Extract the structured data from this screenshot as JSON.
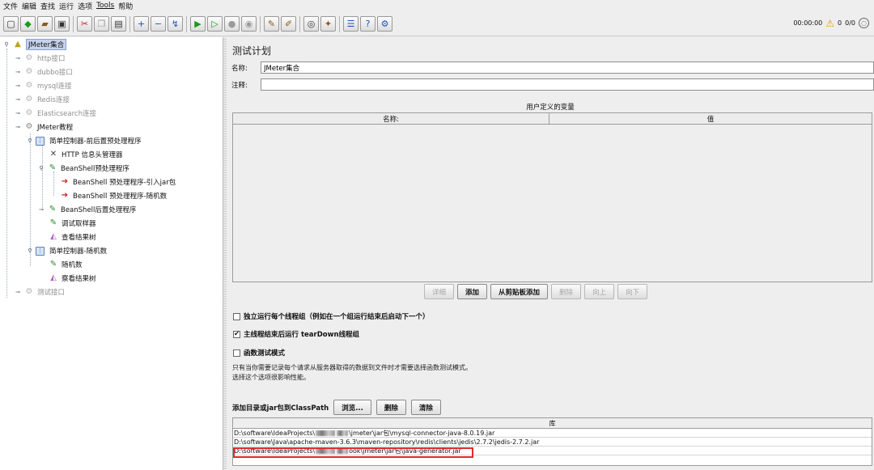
{
  "menu": [
    "文件",
    "编辑",
    "查找",
    "运行",
    "选项",
    "Tools",
    "帮助"
  ],
  "status": {
    "elapsed": "00:00:00",
    "warnings": "0",
    "threads": "0/0"
  },
  "tree": {
    "root": "JMeter集合",
    "nodes": [
      {
        "label": "http接口"
      },
      {
        "label": "dubbo接口"
      },
      {
        "label": "mysql连接"
      },
      {
        "label": "Redis连接"
      },
      {
        "label": "Elasticsearch连接"
      },
      {
        "label": "JMeter教程"
      },
      {
        "label": "简单控制器-前后置预处理程序"
      },
      {
        "label": "HTTP 信息头管理器"
      },
      {
        "label": "BeanShell预处理程序"
      },
      {
        "label": "BeanShell 预处理程序-引入jar包"
      },
      {
        "label": "BeanShell 预处理程序-随机数"
      },
      {
        "label": "BeanShell后置处理程序"
      },
      {
        "label": "调试取样器"
      },
      {
        "label": "查看结果树"
      },
      {
        "label": "简单控制器-随机数"
      },
      {
        "label": "随机数"
      },
      {
        "label": "察看结果树"
      },
      {
        "label": "测试接口"
      }
    ]
  },
  "panel": {
    "title": "测试计划",
    "name_label": "名称:",
    "name_value": "JMeter集合",
    "comment_label": "注释:",
    "comment_value": "",
    "vars_title": "用户定义的变量",
    "col_name": "名称:",
    "col_value": "值",
    "buttons": {
      "detail": "详细",
      "add": "添加",
      "paste": "从剪贴板添加",
      "delete": "删除",
      "up": "向上",
      "down": "向下"
    },
    "chk_independent": "独立运行每个线程组（例如在一个组运行结束后启动下一个）",
    "chk_teardown": "主线程结束后运行 tearDown线程组",
    "chk_functional": "函数测试模式",
    "note_line1": "只有当你需要记录每个请求从服务器取得的数据到文件时才需要选择函数测试模式。",
    "note_line2": "选择这个选项很影响性能。",
    "classpath_label": "添加目录或jar包到ClassPath",
    "cp_buttons": {
      "browse": "浏览...",
      "delete": "删除",
      "clear": "清除"
    },
    "lib_header": "库",
    "libs": [
      {
        "pre": "D:\\software\\IdeaProjects\\",
        "post": "\\jmeter\\jar包\\mysql-connector-java-8.0.19.jar"
      },
      {
        "pre": "D:\\software\\Java\\apache-maven-3.6.3\\maven-repository\\redis\\clients\\jedis\\2.7.2\\jedis-2.7.2.jar",
        "post": ""
      },
      {
        "pre": "D:\\software\\IdeaProjects\\",
        "post": "ook\\jmeter\\jar包\\java-generator.jar"
      }
    ]
  }
}
